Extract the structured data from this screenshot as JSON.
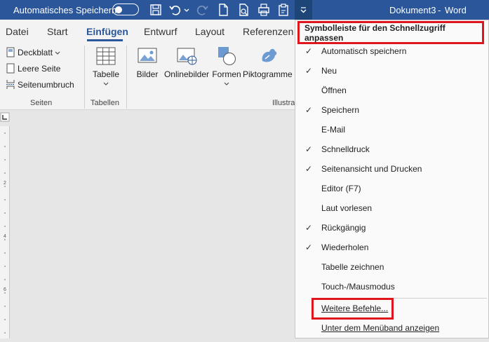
{
  "titlebar": {
    "autosave_label": "Automatisches Speichern",
    "autosave_state": "off",
    "doc_title": "Dokument3",
    "separator": "-",
    "app_name": "Word"
  },
  "tabs": [
    "Datei",
    "Start",
    "Einfügen",
    "Entwurf",
    "Layout",
    "Referenzen"
  ],
  "active_tab": "Einfügen",
  "ribbon": {
    "seiten": {
      "items": [
        "Deckblatt",
        "Leere Seite",
        "Seitenumbruch"
      ],
      "label": "Seiten"
    },
    "tabellen": {
      "button": "Tabelle",
      "label": "Tabellen"
    },
    "illustrationen": {
      "buttons": [
        "Bilder",
        "Onlinebilder",
        "Formen",
        "Piktogramme"
      ],
      "label": "Illustra"
    }
  },
  "menu": {
    "header": "Symbolleiste für den Schnellzugriff anpassen",
    "items": [
      {
        "label": "Automatisch speichern",
        "checked": true
      },
      {
        "label": "Neu",
        "checked": true
      },
      {
        "label": "Öffnen",
        "checked": false
      },
      {
        "label": "Speichern",
        "checked": true
      },
      {
        "label": "E-Mail",
        "checked": false
      },
      {
        "label": "Schnelldruck",
        "checked": true
      },
      {
        "label": "Seitenansicht und Drucken",
        "checked": true
      },
      {
        "label": "Editor (F7)",
        "checked": false
      },
      {
        "label": "Laut vorlesen",
        "checked": false
      },
      {
        "label": "Rückgängig",
        "checked": true
      },
      {
        "label": "Wiederholen",
        "checked": true
      },
      {
        "label": "Tabelle zeichnen",
        "checked": false
      },
      {
        "label": "Touch-/Mausmodus",
        "checked": false
      }
    ],
    "more_commands": "Weitere Befehle...",
    "show_below": "Unter dem Menüband anzeigen",
    "check_glyph": "✓"
  },
  "colors": {
    "word_blue": "#2b579a",
    "highlight_red": "#e0161f"
  }
}
